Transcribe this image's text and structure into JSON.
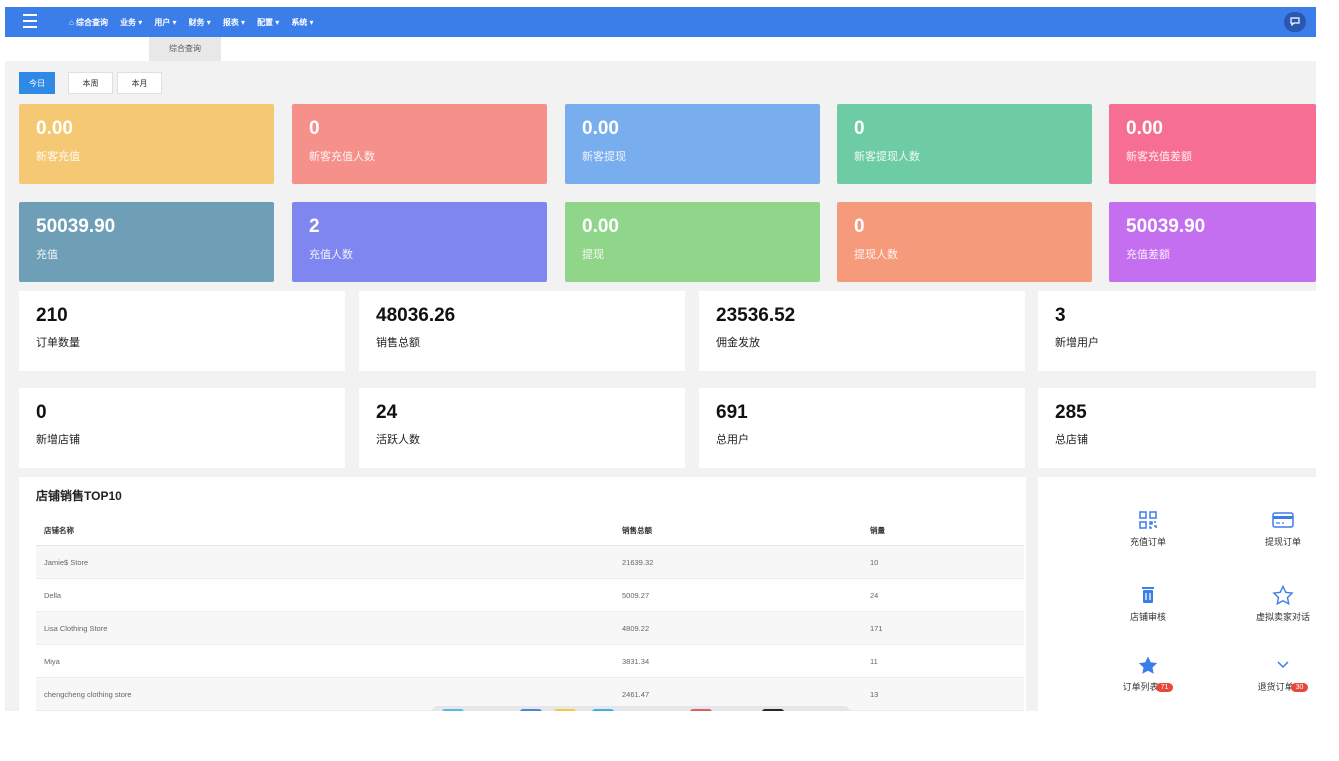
{
  "nav": {
    "items": [
      "⌂ 综合查询",
      "业务 ▾",
      "用户 ▾",
      "财务 ▾",
      "报表 ▾",
      "配置 ▾",
      "系统 ▾"
    ]
  },
  "page_tab": "综合查询",
  "periods": [
    "今日",
    "本周",
    "本月"
  ],
  "color_cards_row1": [
    {
      "value": "0.00",
      "label": "新客充值",
      "color": "#f5c973"
    },
    {
      "value": "0",
      "label": "新客充值人数",
      "color": "#f5908b"
    },
    {
      "value": "0.00",
      "label": "新客提现",
      "color": "#78adee"
    },
    {
      "value": "0",
      "label": "新客提现人数",
      "color": "#6dcca3"
    },
    {
      "value": "0.00",
      "label": "新客充值差额",
      "color": "#f66f92"
    }
  ],
  "color_cards_row2": [
    {
      "value": "50039.90",
      "label": "充值",
      "color": "#6e9fb6"
    },
    {
      "value": "2",
      "label": "充值人数",
      "color": "#7f86f0"
    },
    {
      "value": "0.00",
      "label": "提现",
      "color": "#8fd68a"
    },
    {
      "value": "0",
      "label": "提现人数",
      "color": "#f59b7b"
    },
    {
      "value": "50039.90",
      "label": "充值差额",
      "color": "#c46ef0"
    }
  ],
  "white_cards_row1": [
    {
      "value": "210",
      "label": "订单数量"
    },
    {
      "value": "48036.26",
      "label": "销售总额"
    },
    {
      "value": "23536.52",
      "label": "佣金发放"
    },
    {
      "value": "3",
      "label": "新增用户"
    }
  ],
  "white_cards_row2": [
    {
      "value": "0",
      "label": "新增店铺"
    },
    {
      "value": "24",
      "label": "活跃人数"
    },
    {
      "value": "691",
      "label": "总用户"
    },
    {
      "value": "285",
      "label": "总店铺"
    }
  ],
  "top_stores": {
    "title": "店铺销售TOP10",
    "headers": [
      "店铺名称",
      "销售总额",
      "销量"
    ],
    "rows": [
      [
        "Jamie$ Store",
        "21639.32",
        "10"
      ],
      [
        "Della",
        "5009.27",
        "24"
      ],
      [
        "Lisa Clothing Store",
        "4809.22",
        "171"
      ],
      [
        "Miya",
        "3831.34",
        "11"
      ],
      [
        "chengcheng clothing store",
        "2461.47",
        "13"
      ]
    ]
  },
  "quick_links": [
    {
      "label": "充值订单",
      "icon": "qrcode-icon"
    },
    {
      "label": "提现订单",
      "icon": "credit-card-icon"
    },
    {
      "label": "店铺审核",
      "icon": "trash-icon"
    },
    {
      "label": "虚拟卖家对话",
      "icon": "star-outline-icon"
    },
    {
      "label": "订单列表",
      "icon": "star-filled-icon",
      "badge": "71"
    },
    {
      "label": "退货订单",
      "icon": "chevron-down-icon",
      "badge": "30"
    }
  ]
}
